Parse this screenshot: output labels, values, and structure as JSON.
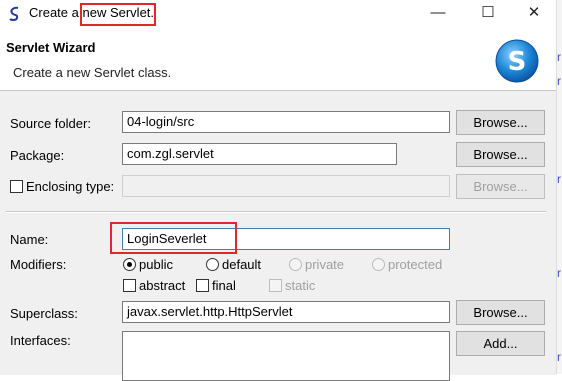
{
  "window": {
    "title_prefix": "Create a ",
    "title_highlight": "new Servlet.",
    "controls": {
      "minimize": "—",
      "maximize": "☐",
      "close": "✕"
    }
  },
  "header": {
    "title": "Servlet Wizard",
    "description": "Create a new Servlet class.",
    "logo_letter": "S"
  },
  "form": {
    "source_folder": {
      "label": "Source folder:",
      "value": "04-login/src",
      "button": "Browse..."
    },
    "package": {
      "label": "Package:",
      "value": "com.zgl.servlet",
      "button": "Browse..."
    },
    "enclosing_type": {
      "label": "Enclosing type:",
      "value": "",
      "button": "Browse...",
      "checked": false
    },
    "name": {
      "label": "Name:",
      "value": "LoginSeverlet"
    },
    "modifiers": {
      "label": "Modifiers:",
      "public": "public",
      "default": "default",
      "private": "private",
      "protected": "protected",
      "selected": "public",
      "abstract": "abstract",
      "final": "final",
      "static": "static"
    },
    "superclass": {
      "label": "Superclass:",
      "value": "javax.servlet.http.HttpServlet",
      "button": "Browse..."
    },
    "interfaces": {
      "label": "Interfaces:",
      "button": "Add..."
    }
  },
  "colors": {
    "highlight": "#e0262f",
    "logo_blue": "#1e88d8",
    "dialog_bg": "#f0f0f0"
  },
  "edge_marks": [
    "r",
    "r",
    "r",
    "r",
    "r"
  ]
}
